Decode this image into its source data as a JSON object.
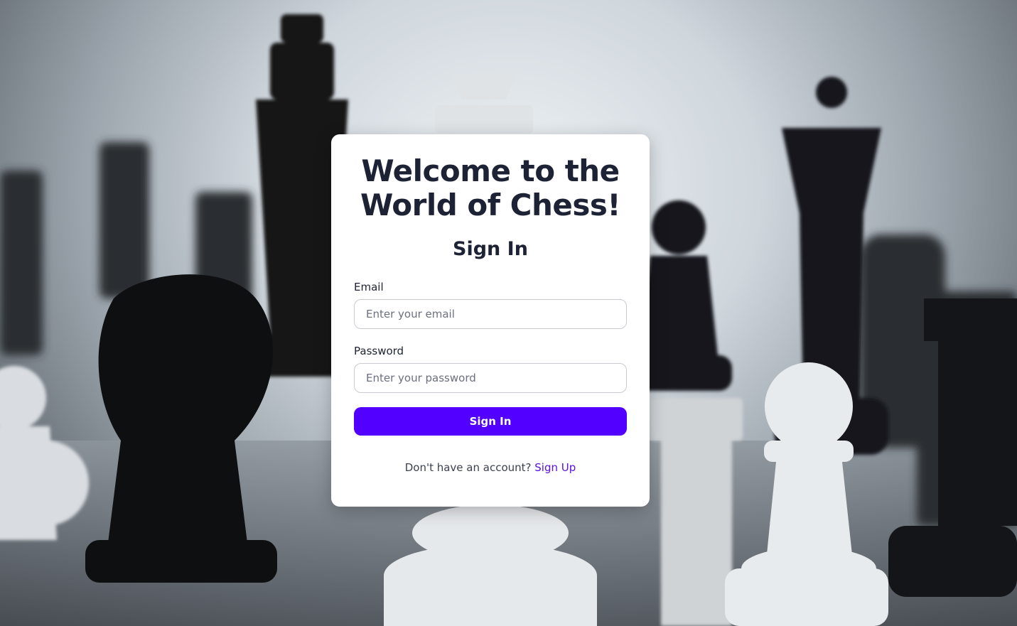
{
  "background": {
    "image_subject": "chess-pieces-photo"
  },
  "card": {
    "title": "Welcome to the World of Chess!",
    "subtitle": "Sign In",
    "email": {
      "label": "Email",
      "value": "",
      "placeholder": "Enter your email"
    },
    "password": {
      "label": "Password",
      "value": "",
      "placeholder": "Enter your password"
    },
    "submit_label": "Sign In",
    "footer_prompt": "Don't have an account?",
    "footer_link": "Sign Up"
  },
  "colors": {
    "accent": "#5200ff",
    "link": "#5a10e8",
    "heading": "#1d2235"
  }
}
